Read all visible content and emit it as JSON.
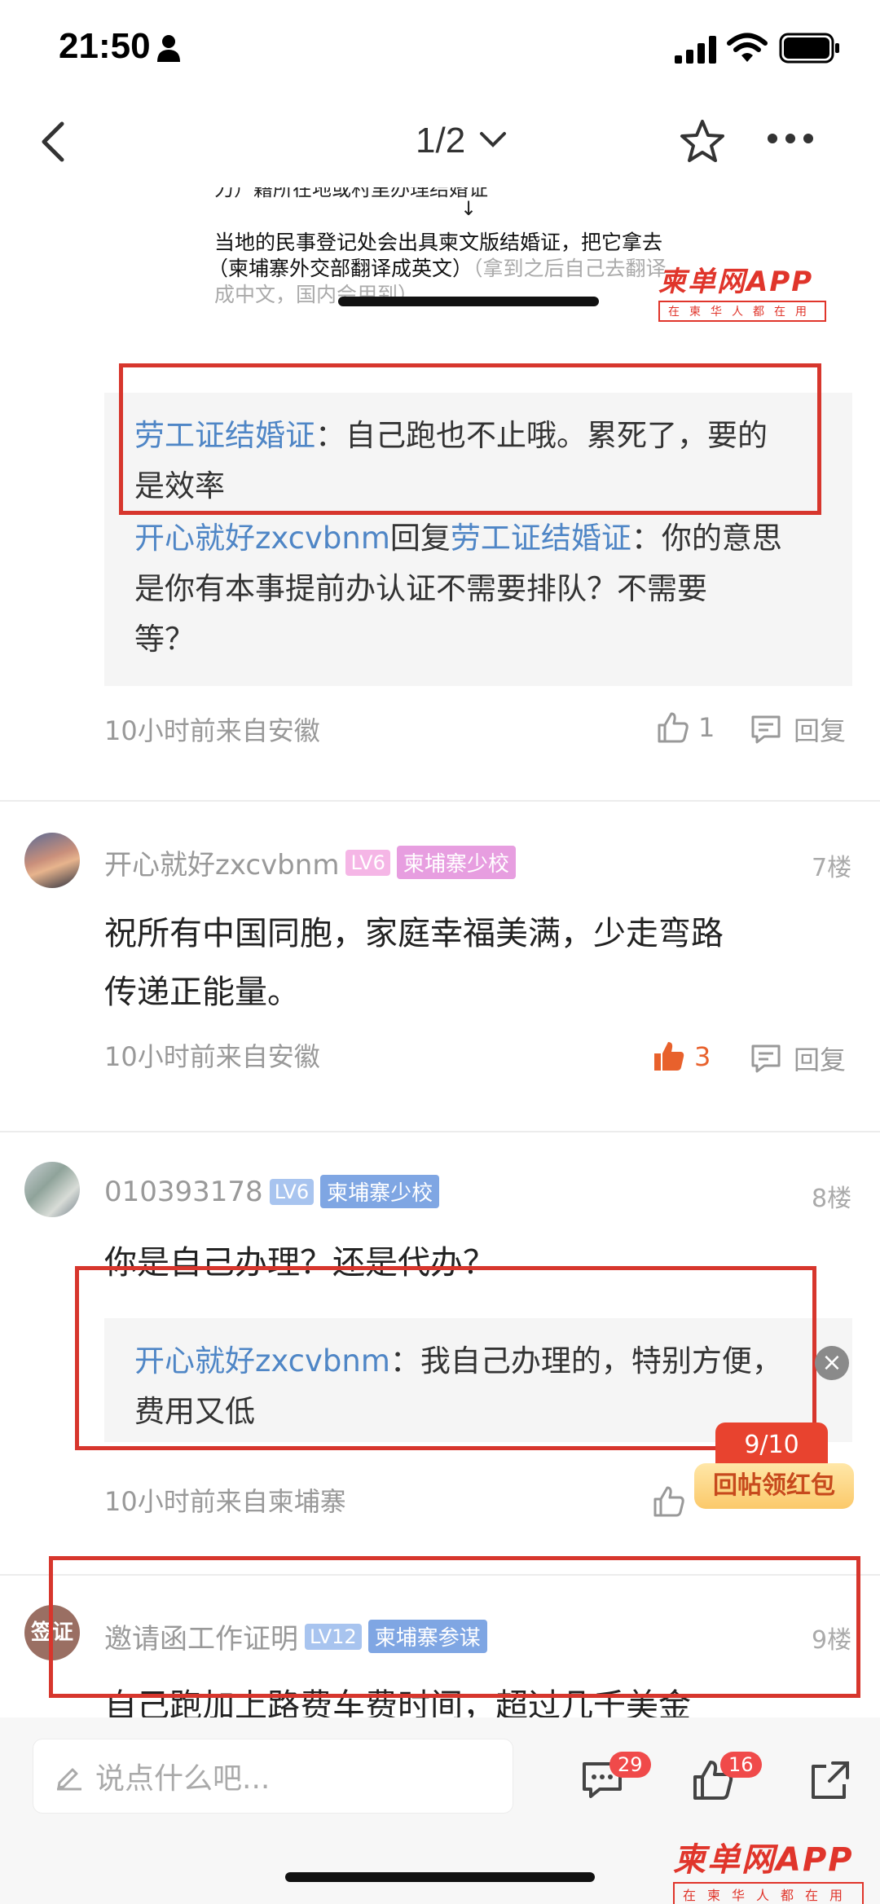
{
  "status": {
    "time": "21:50"
  },
  "nav": {
    "page_indicator": "1/2"
  },
  "doc": {
    "line1": "力）籍所在地或村里办理结婚证",
    "arrow": "↓",
    "line2": "当地的民事登记处会出具柬文版结婚证，把它拿去",
    "line3_black": "（柬埔寨外交部翻译成英文）",
    "line3_grey": "（拿到之后自己去翻译",
    "line4": "成中文，国内会用到）"
  },
  "watermark": {
    "main": "柬单网APP",
    "sub": "在柬华人都在用"
  },
  "post6_replies": {
    "reply1_user": "劳工证结婚证",
    "reply1_text": "：自己跑也不止哦。累死了，要的",
    "reply1_text2": "是效率",
    "reply2_user": "开心就好zxcvbnm",
    "reply2_mid": "回复",
    "reply2_target": "劳工证结婚证",
    "reply2_text": "：你的意思",
    "reply2_line2": "是你有本事提前办认证不需要排队？不需要",
    "reply2_line3": "等？",
    "meta": "10小时前来自安徽",
    "likes": "1",
    "reply_label": "回复"
  },
  "post7": {
    "user": "开心就好zxcvbnm",
    "level": "LV6",
    "tag": "柬埔寨少校",
    "floor": "7楼",
    "line1": "祝所有中国同胞，家庭幸福美满，少走弯路",
    "line2": "传递正能量。",
    "meta": "10小时前来自安徽",
    "likes": "3",
    "reply_label": "回复"
  },
  "post8": {
    "user": "010393178",
    "level": "LV6",
    "tag": "柬埔寨少校",
    "floor": "8楼",
    "line1": "你是自己办理？还是代办？",
    "reply_user": "开心就好zxcvbnm",
    "reply_text": "：我自己办理的，特别方便，",
    "reply_text2": "费用又低",
    "meta": "10小时前来自柬埔寨"
  },
  "post9": {
    "avatar_text": "签证",
    "user": "邀请函工作证明",
    "level": "LV12",
    "tag": "柬埔寨参谋",
    "floor": "9楼",
    "line1": "自己跑加上路费车费时间，超过几千美金"
  },
  "red_packet": {
    "count": "9/10",
    "label": "回帖领红包"
  },
  "bottom": {
    "placeholder": "说点什么吧...",
    "comments": "29",
    "likes": "16"
  },
  "colors": {
    "accent": "#4f86c6",
    "red": "#d7362d",
    "like_orange": "#e8612c"
  }
}
